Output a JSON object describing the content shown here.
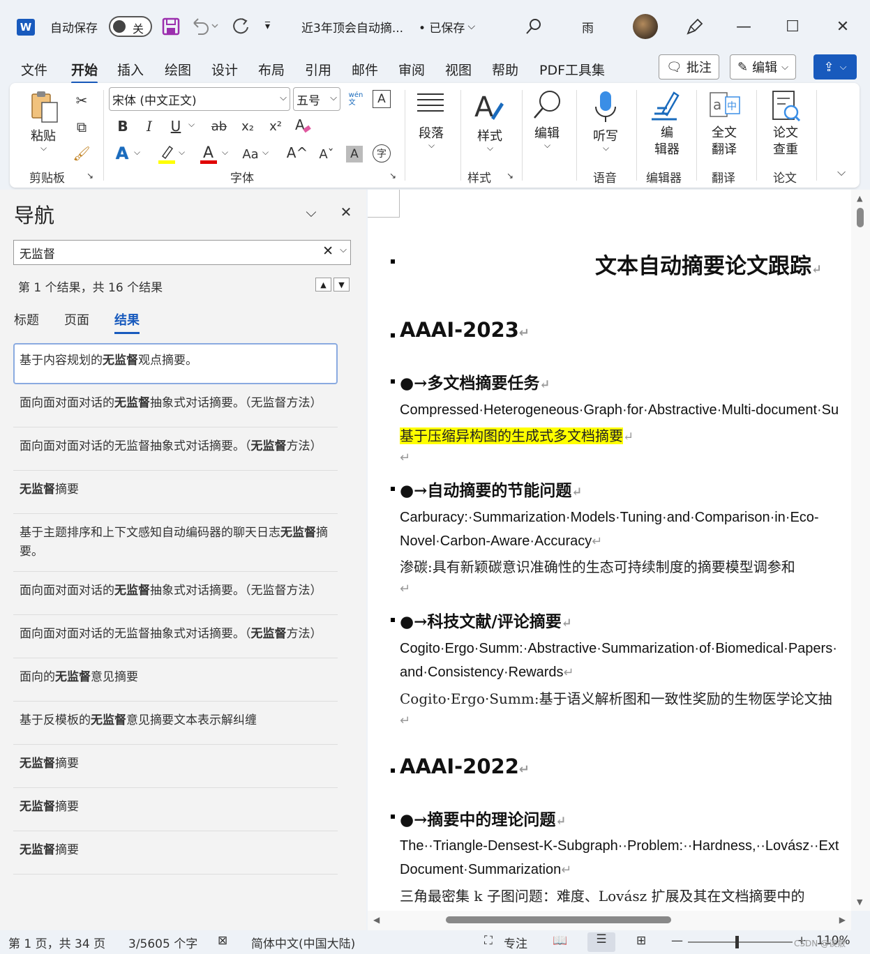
{
  "titlebar": {
    "app_icon": "W",
    "autosave_label": "自动保存",
    "autosave_state": "关",
    "doc_title": "近3年顶会自动摘...",
    "saved_status": "• 已保存",
    "user_name": "雨",
    "icons": [
      "save-icon",
      "undo-icon",
      "redo-icon",
      "customize-icon",
      "search-icon",
      "pen-icon",
      "minimize-icon",
      "maximize-icon",
      "close-icon"
    ]
  },
  "menu": {
    "items": [
      "文件",
      "开始",
      "插入",
      "绘图",
      "设计",
      "布局",
      "引用",
      "邮件",
      "审阅",
      "视图",
      "帮助",
      "PDF工具集"
    ],
    "active": "开始",
    "comment_btn": "批注",
    "edit_btn": "编辑"
  },
  "ribbon": {
    "paste": "粘贴",
    "clipboard_group": "剪贴板",
    "font_name": "宋体 (中文正文)",
    "font_size": "五号",
    "font_group": "字体",
    "paragraph": "段落",
    "styles": "样式",
    "styles_group": "样式",
    "editing": "编辑",
    "dictate": "听写",
    "voice_group": "语音",
    "editor_btn": "编\n辑器",
    "editor_group": "编辑器",
    "translate_btn": "全文\n翻译",
    "translate_group": "翻译",
    "paper_btn": "论文\n查重",
    "paper_group": "论文",
    "phonetic": "wén\n文",
    "fmt": {
      "bold": "B",
      "italic": "I",
      "underline": "U",
      "strike": "ab",
      "sub": "x₂",
      "sup": "x²",
      "fontcolor": "A",
      "case": "Aa",
      "grow": "A^",
      "shrink": "Aˇ",
      "charshade": "A",
      "enclose": "字"
    },
    "highlight_color": "#ffff00",
    "font_color": "#e00000"
  },
  "nav": {
    "title": "导航",
    "search_value": "无监督",
    "result_info": "第 1 个结果，共 16 个结果",
    "tabs": [
      "标题",
      "页面",
      "结果"
    ],
    "active_tab": "结果",
    "results": [
      {
        "pre": "基于内容规划的",
        "bold": "无监督",
        "post": "观点摘要。"
      },
      {
        "pre": "面向面对面对话的",
        "bold": "无监督",
        "post": "抽象式对话摘要。（无监督方法）"
      },
      {
        "pre": "面向面对面对话的无监督抽象式对话摘要。（",
        "bold": "无监督",
        "post": "方法）"
      },
      {
        "pre": "",
        "bold": "无监督",
        "post": "摘要"
      },
      {
        "pre": "基于主题排序和上下文感知自动编码器的聊天日志",
        "bold": "无监督",
        "post": "摘要。"
      },
      {
        "pre": "面向面对面对话的",
        "bold": "无监督",
        "post": "抽象式对话摘要。（无监督方法）"
      },
      {
        "pre": "面向面对面对话的无监督抽象式对话摘要。（",
        "bold": "无监督",
        "post": "方法）"
      },
      {
        "pre": "面向的",
        "bold": "无监督",
        "post": "意见摘要"
      },
      {
        "pre": "基于反模板的",
        "bold": "无监督",
        "post": "意见摘要文本表示解纠缠"
      },
      {
        "pre": "",
        "bold": "无监督",
        "post": "摘要"
      },
      {
        "pre": "",
        "bold": "无监督",
        "post": "摘要"
      },
      {
        "pre": "",
        "bold": "无监督",
        "post": "摘要"
      }
    ]
  },
  "doc": {
    "title": "文本自动摘要论文跟踪",
    "sec1": "AAAI-2023",
    "h_a": "●→多文档摘要任务",
    "a_en": "Compressed·Heterogeneous·Graph·for·Abstractive·Multi-document·Su",
    "a_zh": "基于压缩异构图的生成式多文档摘要",
    "h_b": "●→自动摘要的节能问题",
    "b_en1": "Carburacy:·Summarization·Models·Tuning·and·Comparison·in·Eco-",
    "b_en2": "Novel·Carbon-Aware·Accuracy",
    "b_zh": "渗碳:具有新颖碳意识准确性的生态可持续制度的摘要模型调参和",
    "h_c": "●→科技文献/评论摘要",
    "c_en1": "Cogito·Ergo·Summ:·Abstractive·Summarization·of·Biomedical·Papers·",
    "c_en2": "and·Consistency·Rewards",
    "c_zh": "Cogito·Ergo·Summ:基于语义解析图和一致性奖励的生物医学论文抽",
    "sec2": "AAAI-2022",
    "h_d": "●→摘要中的理论问题",
    "d_en1": "The··Triangle-Densest-K-Subgraph··Problem:··Hardness,··Lovász··Ext",
    "d_en2": "Document·Summarization",
    "d_zh": "三角最密集 k 子图问题：难度、Lovász 扩展及其在文档摘要中的",
    "para_mark": "↵"
  },
  "status": {
    "page": "第 1 页，共 34 页",
    "words": "3/5605 个字",
    "language": "简体中文(中国大陆)",
    "focus": "专注",
    "zoom": "110%",
    "watermark": "CSDN @诶敷"
  }
}
